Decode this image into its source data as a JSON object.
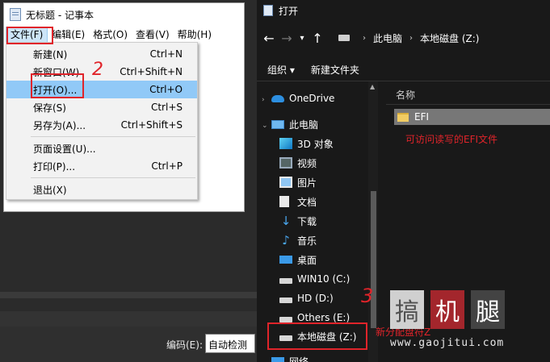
{
  "notepad": {
    "title": "无标题 - 记事本",
    "menu": [
      "文件(F)",
      "编辑(E)",
      "格式(O)",
      "查看(V)",
      "帮助(H)"
    ],
    "file_menu": [
      {
        "label": "新建(N)",
        "shortcut": "Ctrl+N"
      },
      {
        "label": "新窗口(W)",
        "shortcut": "Ctrl+Shift+N"
      },
      {
        "label": "打开(O)...",
        "shortcut": "Ctrl+O",
        "highlighted": true
      },
      {
        "label": "保存(S)",
        "shortcut": "Ctrl+S"
      },
      {
        "label": "另存为(A)...",
        "shortcut": "Ctrl+Shift+S"
      },
      {
        "label": "页面设置(U)...",
        "shortcut": ""
      },
      {
        "label": "打印(P)...",
        "shortcut": "Ctrl+P"
      },
      {
        "label": "退出(X)",
        "shortcut": ""
      }
    ],
    "status": {
      "encoding_label": "编码(E):",
      "encoding_value": "自动检测"
    }
  },
  "explorer": {
    "title": "打开",
    "address": [
      "此电脑",
      "本地磁盘 (Z:)"
    ],
    "toolbar": [
      "组织",
      "新建文件夹"
    ],
    "nav": {
      "onedrive": "OneDrive",
      "this_pc": "此电脑",
      "objects_3d": "3D 对象",
      "videos": "视频",
      "pictures": "图片",
      "documents": "文档",
      "downloads": "下载",
      "music": "音乐",
      "desktop": "桌面",
      "drive_c": "WIN10 (C:)",
      "drive_d": "HD (D:)",
      "drive_e": "Others (E:)",
      "drive_z": "本地磁盘 (Z:)",
      "network": "网络"
    },
    "column_name": "名称",
    "folder": "EFI"
  },
  "annotations": {
    "step2": "2",
    "step3": "3",
    "folder_note": "可访问读写的EFI文件",
    "drive_note": "新分配盘符Z"
  },
  "watermark": {
    "chars": [
      "搞",
      "机",
      "腿"
    ],
    "url": "www.gaojitui.com"
  },
  "colors": {
    "annotation": "#e0242a",
    "highlight": "#91c9f7",
    "explorer_bg": "#191919"
  }
}
